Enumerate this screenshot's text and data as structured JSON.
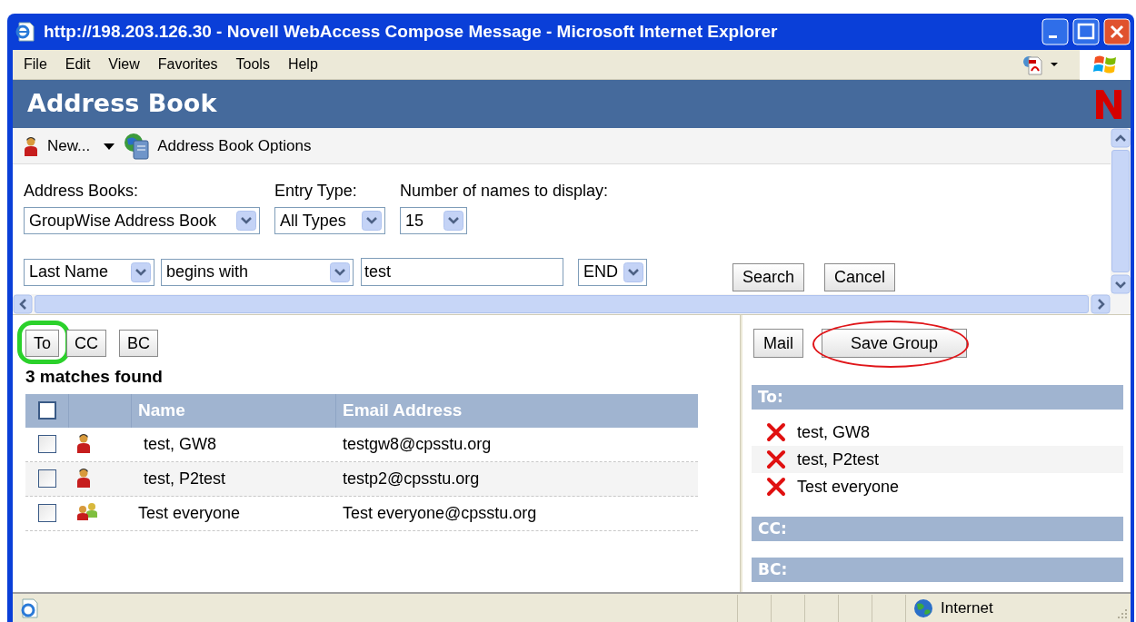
{
  "window": {
    "title": "http://198.203.126.30 - Novell WebAccess Compose Message - Microsoft Internet Explorer"
  },
  "menu": [
    "File",
    "Edit",
    "View",
    "Favorites",
    "Tools",
    "Help"
  ],
  "header": {
    "title": "Address Book"
  },
  "toolbar": {
    "new_label": "New...",
    "options_label": "Address Book Options"
  },
  "filters": [
    {
      "label": "Address Books:",
      "value": "GroupWise Address Book"
    },
    {
      "label": "Entry Type:",
      "value": "All Types"
    },
    {
      "label": "Number of names to display:",
      "value": "15"
    }
  ],
  "search": {
    "field": "Last Name",
    "operator": "begins with",
    "text": "test",
    "end": "END",
    "buttons": [
      "Search",
      "Cancel"
    ]
  },
  "recipient_buttons": [
    {
      "label": "To",
      "highlighted": true
    },
    {
      "label": "CC",
      "highlighted": false
    },
    {
      "label": "BC",
      "highlighted": false
    }
  ],
  "matches": "3 matches found",
  "table": {
    "header_checked": false,
    "columns": [
      "Name",
      "Email Address"
    ],
    "rows": [
      {
        "kind": "person",
        "checked": false,
        "name": "test, GW8",
        "email": "testgw8@cpsstu.org"
      },
      {
        "kind": "person",
        "checked": false,
        "name": "test, P2test",
        "email": "testp2@cpsstu.org"
      },
      {
        "kind": "group",
        "checked": false,
        "name": "Test everyone",
        "email": "Test everyone@cpsstu.org"
      }
    ]
  },
  "actions": [
    {
      "label": "Mail",
      "highlighted": false
    },
    {
      "label": "Save Group",
      "highlighted": true
    }
  ],
  "sections": [
    {
      "label": "To:",
      "entries": [
        "test, GW8",
        "test, P2test",
        "Test everyone"
      ]
    },
    {
      "label": "CC:"
    },
    {
      "label": "BC:"
    }
  ],
  "status_bar": {
    "zone": "Internet"
  }
}
